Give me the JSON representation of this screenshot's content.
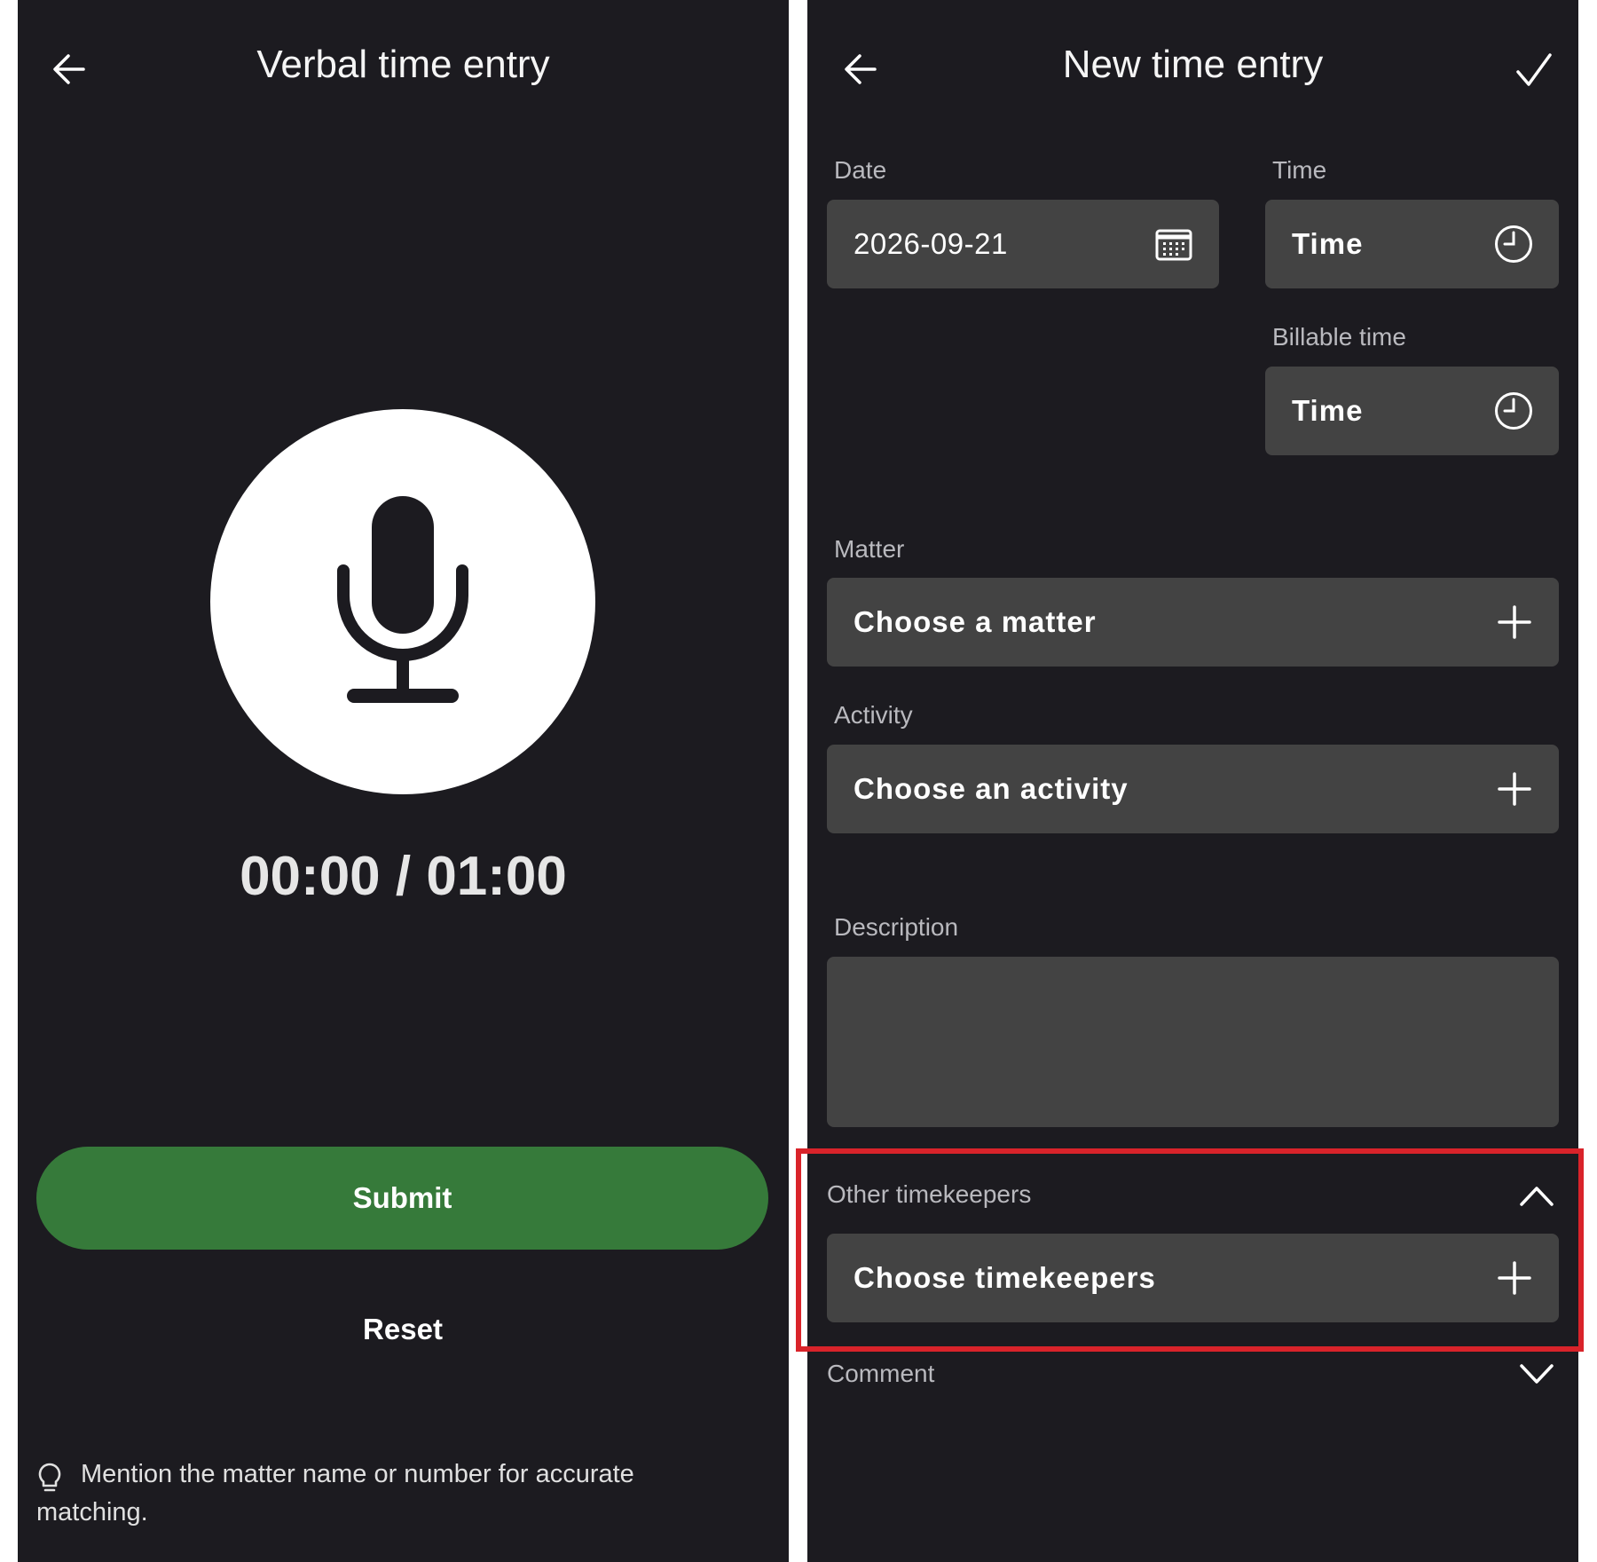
{
  "left": {
    "title": "Verbal time entry",
    "back_icon": "arrow-left-icon",
    "mic_icon": "microphone-icon",
    "timer": "00:00 / 01:00",
    "submit_label": "Submit",
    "reset_label": "Reset",
    "hint_icon": "lightbulb-icon",
    "hint": "Mention the matter name or number for accurate matching."
  },
  "right": {
    "title": "New time entry",
    "back_icon": "arrow-left-icon",
    "confirm_icon": "check-icon",
    "date": {
      "label": "Date",
      "value": "2026-09-21",
      "icon": "calendar-icon"
    },
    "time": {
      "label": "Time",
      "value": "Time",
      "icon": "clock-icon"
    },
    "billable_time": {
      "label": "Billable time",
      "value": "Time",
      "icon": "clock-icon"
    },
    "matter": {
      "label": "Matter",
      "value": "Choose a matter",
      "icon": "plus-icon"
    },
    "activity": {
      "label": "Activity",
      "value": "Choose an activity",
      "icon": "plus-icon"
    },
    "description": {
      "label": "Description",
      "value": ""
    },
    "other_timekeepers": {
      "label": "Other timekeepers",
      "value": "Choose timekeepers",
      "toggle_icon": "chevron-up-icon",
      "icon": "plus-icon",
      "expanded": true
    },
    "comment": {
      "label": "Comment",
      "toggle_icon": "chevron-down-icon",
      "expanded": false
    }
  },
  "colors": {
    "background": "#1c1b20",
    "field": "#434343",
    "submit": "#367a3a",
    "highlight": "#d9232a",
    "label": "#b9b9be"
  }
}
